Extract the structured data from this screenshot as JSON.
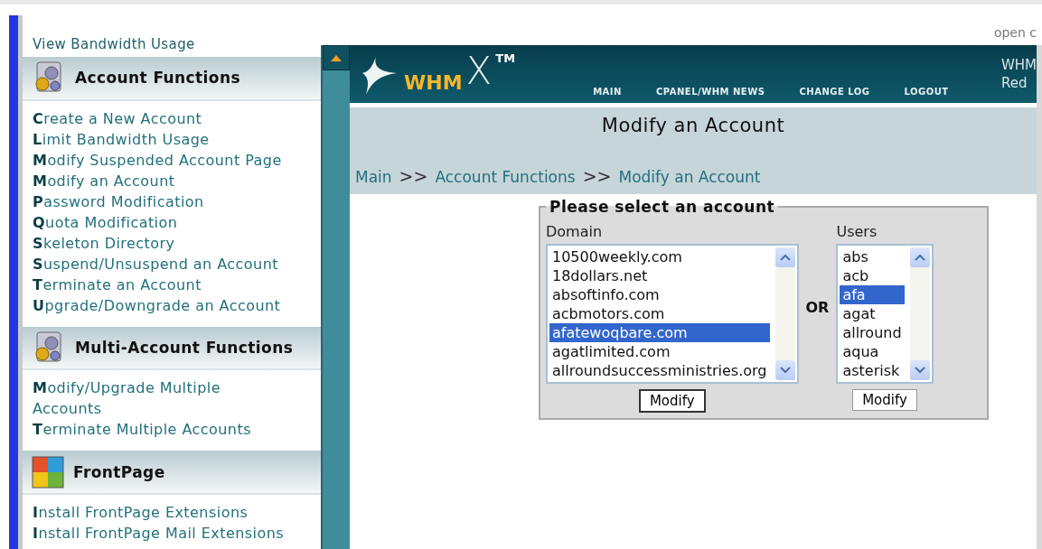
{
  "top_note": "open c",
  "sidebar": {
    "partial_link": "View Bandwidth Usage",
    "sections": [
      {
        "title": "Account Functions",
        "links": [
          "Create a New Account",
          "Limit Bandwidth Usage",
          "Modify Suspended Account Page",
          "Modify an Account",
          "Password Modification",
          "Quota Modification",
          "Skeleton Directory",
          "Suspend/Unsuspend an Account",
          "Terminate an Account",
          "Upgrade/Downgrade an Account"
        ]
      },
      {
        "title": "Multi-Account Functions",
        "links": [
          "Modify/Upgrade Multiple Accounts",
          "Terminate Multiple Accounts"
        ]
      },
      {
        "title": "FrontPage",
        "links": [
          "Install FrontPage Extensions",
          "Install FrontPage Mail Extensions"
        ]
      }
    ]
  },
  "header": {
    "logo": "WHM",
    "logo_x": "X",
    "trademark": "TM",
    "nav": [
      "MAIN",
      "CPANEL/WHM NEWS",
      "CHANGE LOG",
      "LOGOUT"
    ],
    "corner": [
      "WHM",
      "Red"
    ]
  },
  "page_title": "Modify an Account",
  "breadcrumb": {
    "items": [
      "Main",
      "Account Functions",
      "Modify an Account"
    ],
    "separator": ">>"
  },
  "form": {
    "legend": "Please select an account",
    "or": "OR",
    "domain": {
      "label": "Domain",
      "button": "Modify",
      "options": [
        {
          "text": "10500weekly.com",
          "selected": false
        },
        {
          "text": "18dollars.net",
          "selected": false
        },
        {
          "text": "absoftinfo.com",
          "selected": false
        },
        {
          "text": "acbmotors.com",
          "selected": false
        },
        {
          "text": "afatewoqbare.com",
          "selected": true
        },
        {
          "text": "agatlimited.com",
          "selected": false
        },
        {
          "text": "allroundsuccessministries.org",
          "selected": false
        }
      ]
    },
    "users": {
      "label": "Users",
      "button": "Modify",
      "options": [
        {
          "text": "abs",
          "selected": false
        },
        {
          "text": "acb",
          "selected": false
        },
        {
          "text": "afa",
          "selected": true
        },
        {
          "text": "agat",
          "selected": false
        },
        {
          "text": "allround",
          "selected": false
        },
        {
          "text": "aqua",
          "selected": false
        },
        {
          "text": "asterisk",
          "selected": false
        }
      ]
    }
  }
}
